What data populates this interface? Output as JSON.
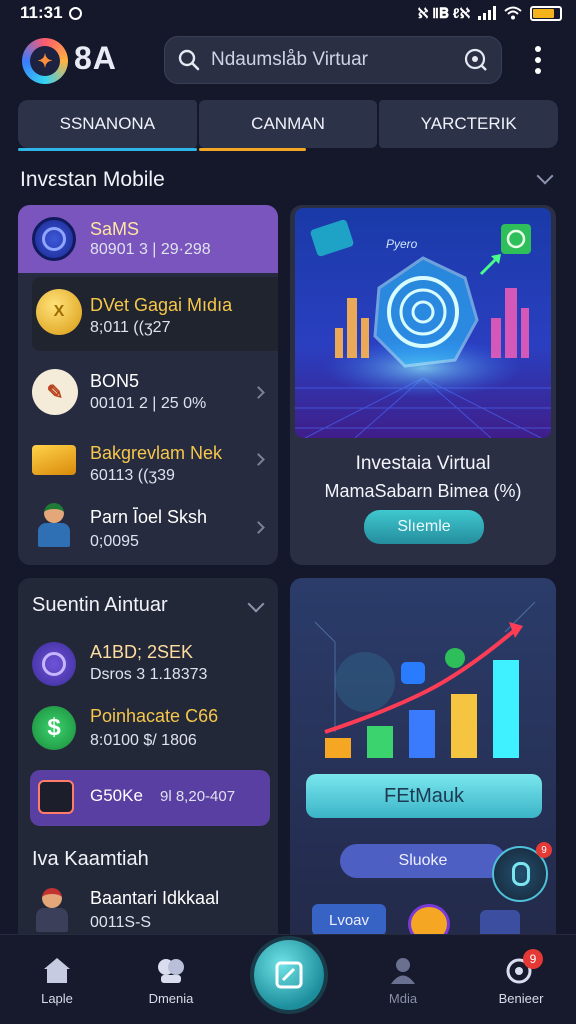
{
  "status_bar": {
    "time": "11:31",
    "right_icons": "ℵ Ⅱ𝐁 ℓℵ"
  },
  "header": {
    "brand": "8A",
    "search_placeholder": "Ndaumslåb Virtuar"
  },
  "tabs": [
    {
      "label": "SSNANONA"
    },
    {
      "label": "CANMAN"
    },
    {
      "label": "YARCTERIK"
    }
  ],
  "section1": {
    "title": "Invεstan Mobile",
    "items": [
      {
        "name": "SaMS",
        "value": "80901 3 | 29·298"
      },
      {
        "name": "DVet Gagai Mıdıa",
        "value": "8;011 ((ʒ27"
      },
      {
        "name": "BON5",
        "value": "00101 2 | 25 0%"
      },
      {
        "name": "Bakgrevlam Nek",
        "value": "60113 ((ʒ39"
      },
      {
        "name": "Parn Ī̈oel Sksh",
        "value": "0;0095"
      }
    ],
    "feature": {
      "caption_line1": "Investaia Virtual",
      "caption_line2": "MamaSabarn Bimea (%)",
      "button": "Slıemle",
      "hud_text": "Pyero"
    }
  },
  "section2": {
    "title": "Suentin Aintuar",
    "items": [
      {
        "name": "A1BD; 2SEK",
        "value": "Dsros 3 1.18373"
      },
      {
        "name": "Poinhacate C66",
        "value": "8:0100 $/ 1806"
      },
      {
        "name": "G50Ke",
        "value": "9l 8,20-407"
      }
    ],
    "subtitle": "Iva Kaamtiah",
    "extra_item": {
      "name": "Baantari Idkkaal",
      "value": "0011S-S"
    },
    "feature": {
      "primary_button": "FEtMauk",
      "secondary_button": "Sluoke",
      "tertiary_button": "Lvoav",
      "badge_count": "9"
    }
  },
  "nav": {
    "items": [
      {
        "label": "Laple",
        "icon": "home-icon"
      },
      {
        "label": "Dmenia",
        "icon": "community-icon"
      },
      {
        "label": "Mdia",
        "icon": "profile-icon"
      },
      {
        "label": "Benieer",
        "icon": "settings-icon",
        "badge": "9"
      }
    ]
  },
  "colors": {
    "accent": "#2fb6e8",
    "background": "#14182a",
    "card": "#262b3f",
    "highlight_purple": "#7452b8",
    "gold": "#f5c542"
  }
}
